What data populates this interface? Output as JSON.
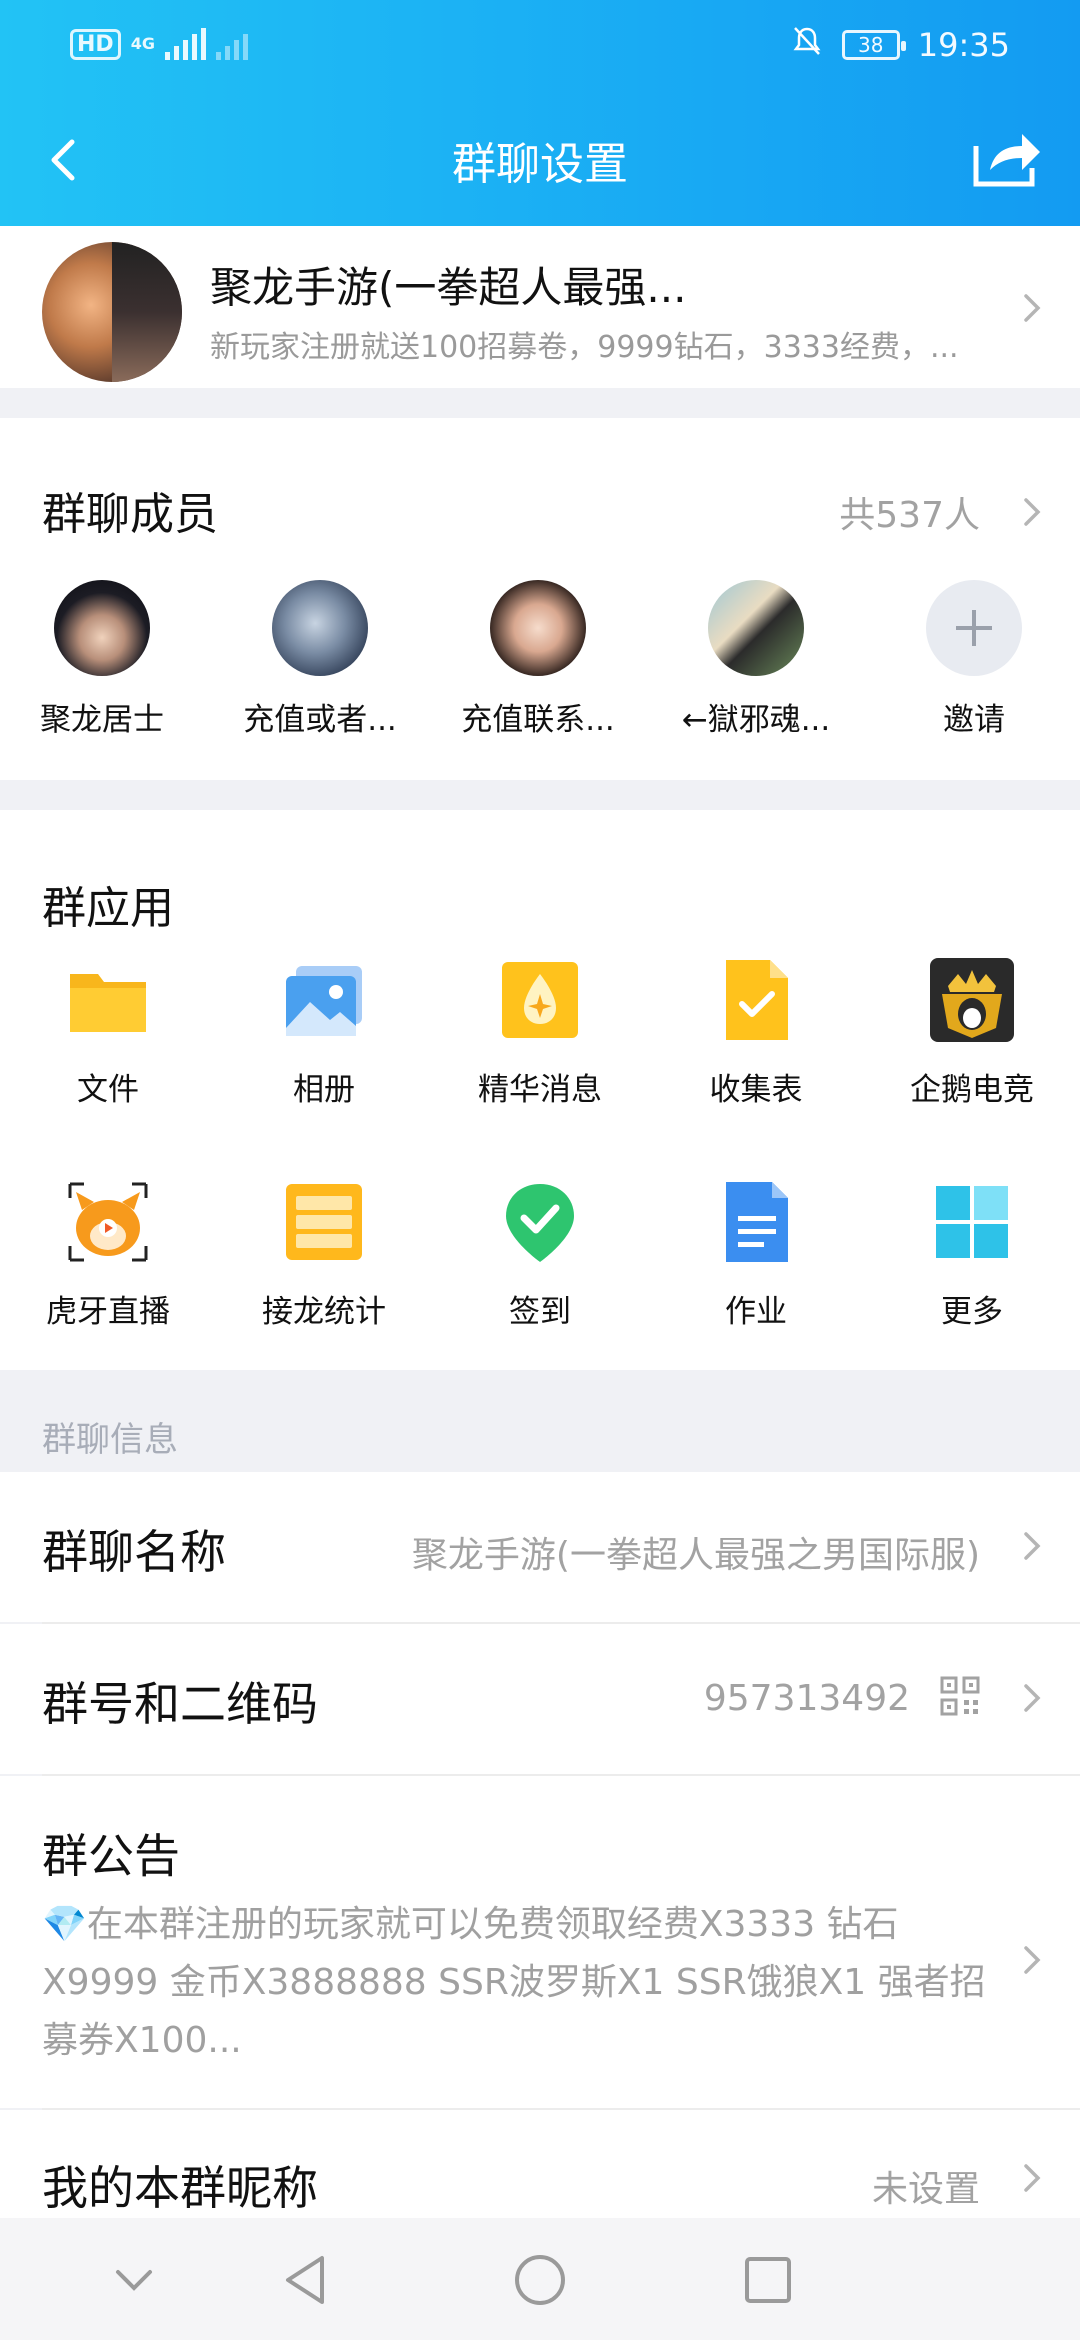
{
  "status_bar": {
    "time": "19:35",
    "battery": "38",
    "network": "4G",
    "hd": "HD"
  },
  "header": {
    "title": "群聊设置"
  },
  "group": {
    "name": "聚龙手游(一拳超人最强...",
    "description": "新玩家注册就送100招募卷，9999钻石，3333经费，..."
  },
  "members": {
    "title": "群聊成员",
    "count": "共537人",
    "items": [
      {
        "name": "聚龙居士"
      },
      {
        "name": "充值或者..."
      },
      {
        "name": "充值联系..."
      },
      {
        "name": "←獄邪魂..."
      },
      {
        "name": "邀请"
      }
    ]
  },
  "apps": {
    "title": "群应用",
    "items": [
      {
        "label": "文件",
        "icon": "folder-icon"
      },
      {
        "label": "相册",
        "icon": "album-icon"
      },
      {
        "label": "精华消息",
        "icon": "essence-icon"
      },
      {
        "label": "收集表",
        "icon": "form-icon"
      },
      {
        "label": "企鹅电竞",
        "icon": "penguin-esports-icon"
      },
      {
        "label": "虎牙直播",
        "icon": "huya-icon"
      },
      {
        "label": "接龙统计",
        "icon": "chain-stats-icon"
      },
      {
        "label": "签到",
        "icon": "checkin-icon"
      },
      {
        "label": "作业",
        "icon": "homework-icon"
      },
      {
        "label": "更多",
        "icon": "more-apps-icon"
      }
    ]
  },
  "info": {
    "section_label": "群聊信息",
    "group_name_label": "群聊名称",
    "group_name_value": "聚龙手游(一拳超人最强之男国际服)",
    "group_id_label": "群号和二维码",
    "group_id_value": "957313492",
    "notice_label": "群公告",
    "notice_text": "💎在本群注册的玩家就可以免费领取经费X3333 钻石X9999 金币X3888888 SSR波罗斯X1 SSR饿狼X1 强者招募券X100...",
    "nickname_label": "我的本群昵称",
    "nickname_value": "未设置"
  },
  "colors": {
    "header_start": "#22c3f5",
    "header_end": "#139bf2",
    "secondary_text": "#a2a2a2"
  }
}
